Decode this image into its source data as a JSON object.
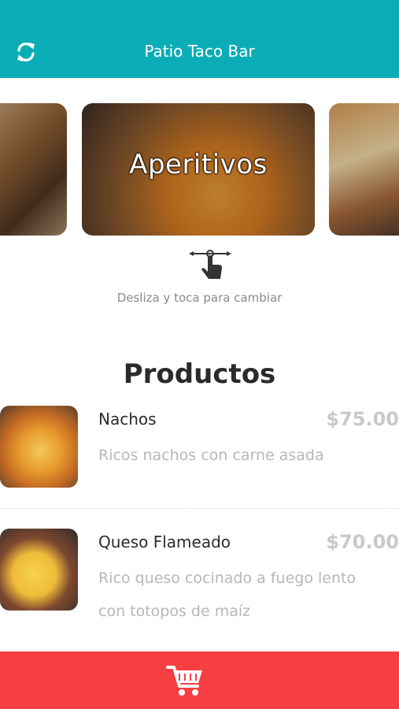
{
  "header": {
    "title": "Patio Taco Bar",
    "refresh_icon": "refresh-icon"
  },
  "carousel": {
    "current_label": "Aperitivos",
    "hint": "Desliza y toca para cambiar",
    "swipe_icon": "swipe-gesture-icon"
  },
  "section": {
    "title": "Productos"
  },
  "products": [
    {
      "name": "Nachos",
      "price": "$75.00",
      "description": "Ricos nachos con carne asada"
    },
    {
      "name": "Queso Flameado",
      "price": "$70.00",
      "description": "Rico queso cocinado a fuego lento con totopos de maíz"
    }
  ],
  "cart": {
    "icon": "cart-icon"
  },
  "colors": {
    "header": "#0AADB6",
    "cart_bar": "#F63F43"
  }
}
